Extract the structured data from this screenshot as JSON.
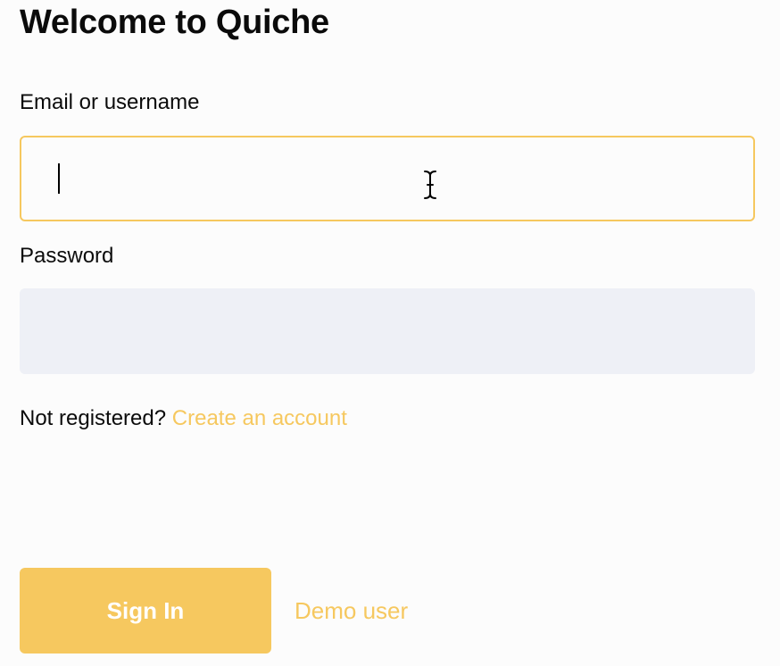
{
  "page": {
    "title": "Welcome to Quiche"
  },
  "form": {
    "email_label": "Email or username",
    "email_value": "",
    "password_label": "Password",
    "password_value": ""
  },
  "register": {
    "prompt": "Not registered?",
    "link_label": "Create an account"
  },
  "actions": {
    "signin_label": "Sign In",
    "demo_label": "Demo user"
  },
  "colors": {
    "accent": "#f6c85f",
    "field_fill": "#eef0f6",
    "background": "#fcfcfc",
    "text": "#0b0b0b"
  },
  "icons": {
    "text_cursor": "text-cursor-icon"
  }
}
